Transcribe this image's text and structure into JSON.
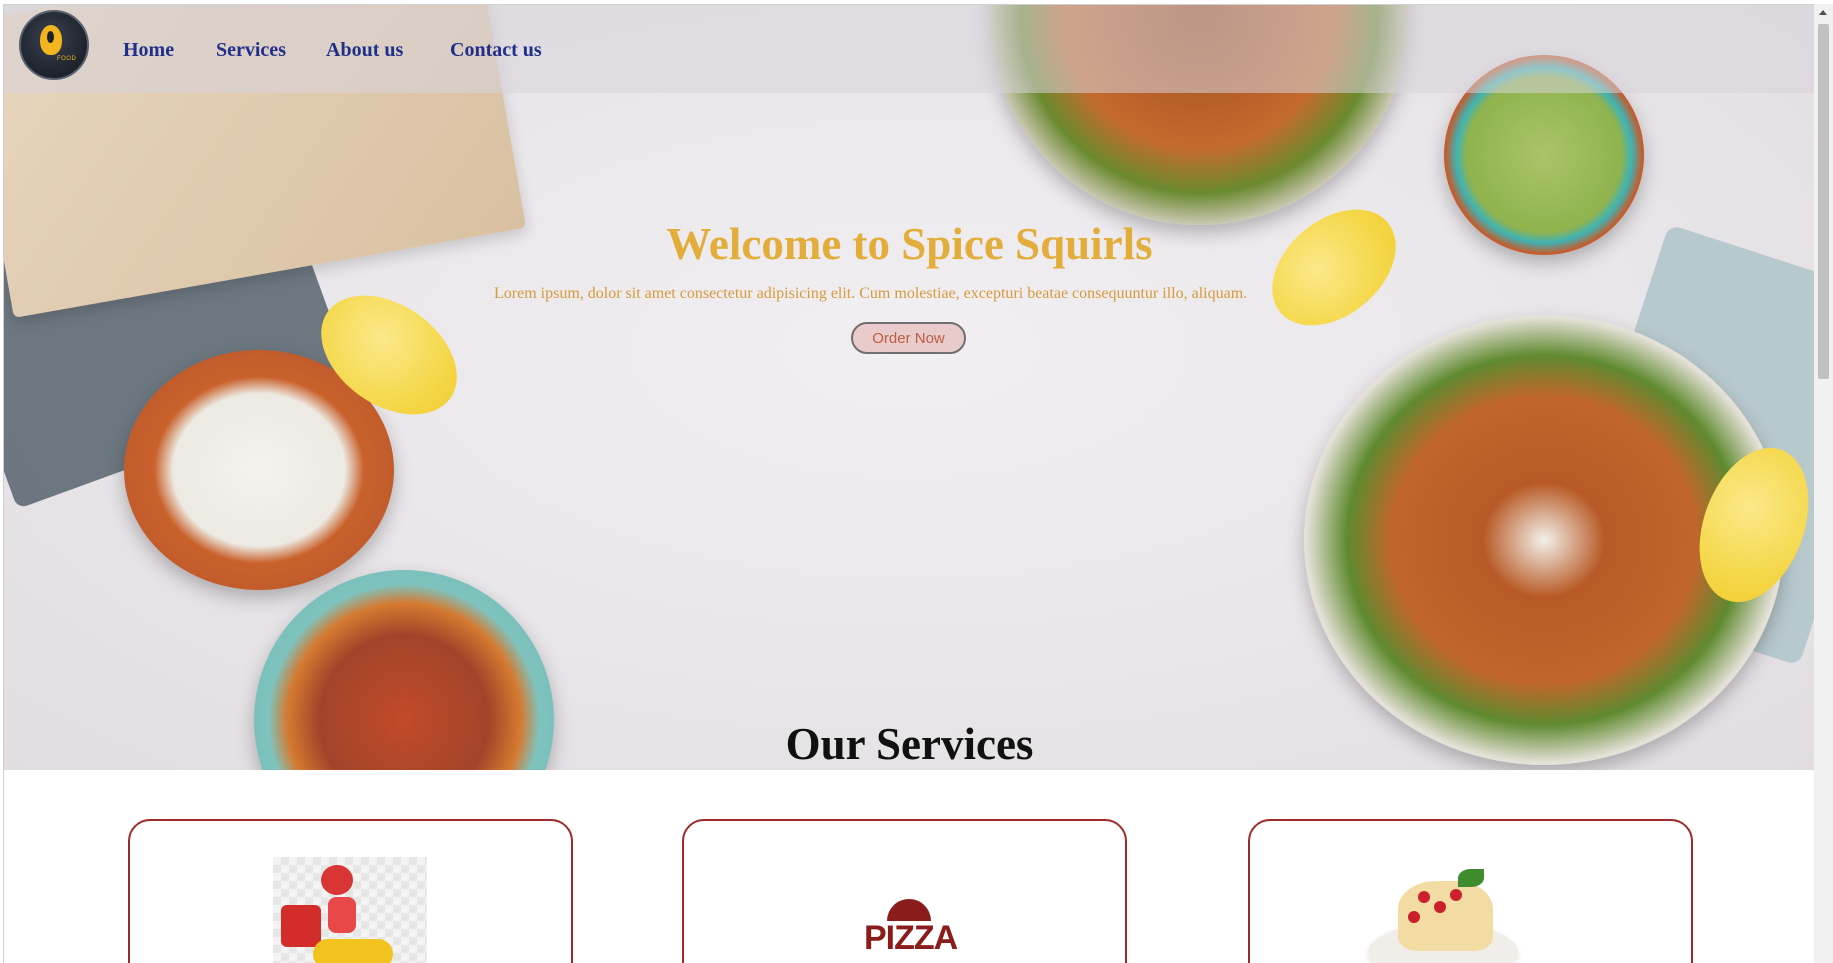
{
  "nav": {
    "logo_text": "FOOD",
    "items": [
      {
        "label": "Home"
      },
      {
        "label": "Services"
      },
      {
        "label": "About us"
      },
      {
        "label": "Contact us"
      }
    ]
  },
  "hero": {
    "title": "Welcome to Spice Squirls",
    "tagline": "Lorem ipsum, dolor sit amet consectetur adipisicing elit. Cum molestiae, excepturi beatae consequuntur illo, aliquam.",
    "order_button": "Order Now"
  },
  "services": {
    "title": "Our Services",
    "cards": [
      {
        "image": "delivery-rider-image"
      },
      {
        "image": "pizza-logo-image",
        "logo_text": "PIZZA"
      },
      {
        "image": "crepe-dessert-image"
      }
    ]
  },
  "colors": {
    "accent_gold": "#e3ad3b",
    "nav_blue": "#1f2f8a",
    "card_border": "#9d2a2a"
  }
}
